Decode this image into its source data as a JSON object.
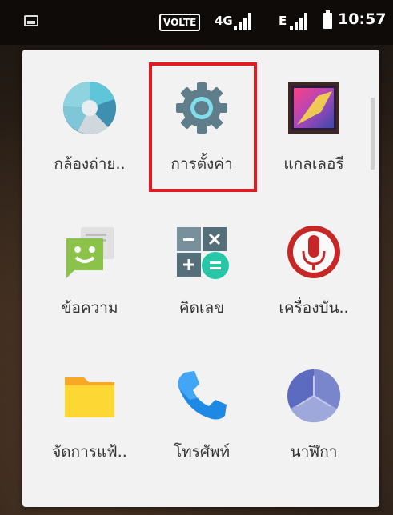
{
  "status_bar": {
    "volte": "VOLTE",
    "network_1": "4G",
    "network_2": "E",
    "time": "10:57",
    "icons": [
      "screenshot-icon",
      "signal-icon",
      "signal-icon",
      "battery-icon"
    ]
  },
  "apps": [
    {
      "label": "กล้องถ่าย..",
      "icon": "camera-icon"
    },
    {
      "label": "การตั้งค่า",
      "icon": "settings-icon"
    },
    {
      "label": "แกลเลอรี",
      "icon": "gallery-icon"
    },
    {
      "label": "ข้อความ",
      "icon": "messaging-icon"
    },
    {
      "label": "คิดเลข",
      "icon": "calculator-icon"
    },
    {
      "label": "เครื่องบัน..",
      "icon": "voice-recorder-icon"
    },
    {
      "label": "จัดการแฟ้..",
      "icon": "file-manager-icon"
    },
    {
      "label": "โทรศัพท์",
      "icon": "phone-icon"
    },
    {
      "label": "นาฬิกา",
      "icon": "clock-icon"
    }
  ],
  "highlight_color": "#e21a22"
}
